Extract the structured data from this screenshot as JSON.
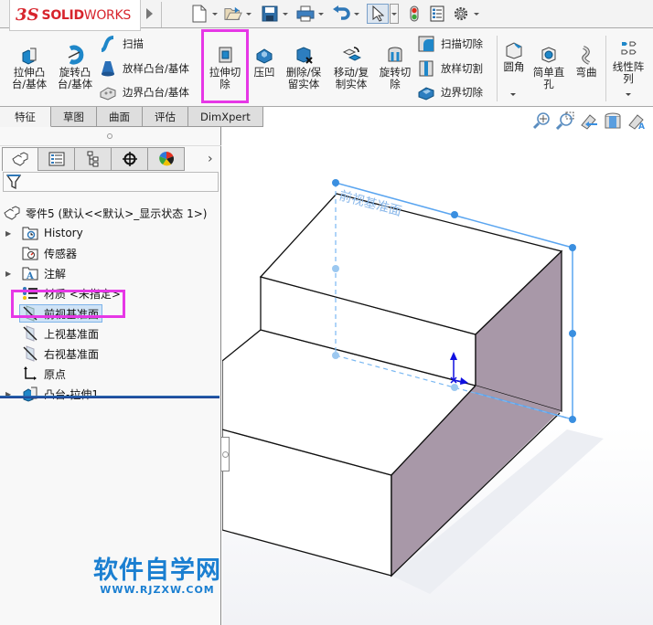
{
  "app": {
    "brand_mark": "3S",
    "brand_bold": "SOLID",
    "brand_light": "WORKS"
  },
  "quick_access": [
    {
      "name": "new-document",
      "icon": "document-icon"
    },
    {
      "name": "open",
      "icon": "folder-open-icon"
    },
    {
      "name": "save",
      "icon": "save-icon"
    },
    {
      "name": "print",
      "icon": "printer-icon"
    },
    {
      "name": "undo",
      "icon": "undo-icon"
    },
    {
      "name": "select",
      "icon": "cursor-icon"
    },
    {
      "name": "rebuild",
      "icon": "traffic-light-icon"
    },
    {
      "name": "file-properties",
      "icon": "properties-icon"
    },
    {
      "name": "options",
      "icon": "gear-icon"
    }
  ],
  "ribbon": {
    "extrude_boss_l1": "拉伸凸",
    "extrude_boss_l2": "台/基体",
    "revolve_boss_l1": "旋转凸",
    "revolve_boss_l2": "台/基体",
    "sweep": "扫描",
    "loft_boss": "放样凸台/基体",
    "boundary_boss": "边界凸台/基体",
    "extrude_cut_l1": "拉伸切",
    "extrude_cut_l2": "除",
    "indent": "压凹",
    "delete_keep_l1": "删除/保",
    "delete_keep_l2": "留实体",
    "move_copy_l1": "移动/复",
    "move_copy_l2": "制实体",
    "revolve_cut_l1": "旋转切",
    "revolve_cut_l2": "除",
    "swept_cut": "扫描切除",
    "lofted_cut": "放样切割",
    "boundary_cut": "边界切除",
    "fillet": "圆角",
    "simple_hole_l1": "简单直",
    "simple_hole_l2": "孔",
    "flex": "弯曲",
    "linear_pattern_l1": "线性阵",
    "linear_pattern_l2": "列"
  },
  "tabs": [
    "特征",
    "草图",
    "曲面",
    "评估",
    "DimXpert"
  ],
  "active_tab": "特征",
  "panel_tabs": [
    {
      "name": "feature-manager",
      "icon": "part-icon"
    },
    {
      "name": "property-manager",
      "icon": "list-icon"
    },
    {
      "name": "configuration-manager",
      "icon": "config-tree-icon"
    },
    {
      "name": "dimxpert-manager",
      "icon": "crosshair-icon"
    },
    {
      "name": "display-manager",
      "icon": "color-wheel-icon"
    }
  ],
  "tree": {
    "root": "零件5  (默认<<默认>_显示状态 1>)",
    "items": [
      {
        "label": "History",
        "expandable": true,
        "icon": "history-folder-icon"
      },
      {
        "label": "传感器",
        "expandable": false,
        "icon": "sensor-folder-icon"
      },
      {
        "label": "注解",
        "expandable": true,
        "icon": "annotation-folder-icon"
      },
      {
        "label": "材质 <未指定>",
        "expandable": false,
        "icon": "material-icon"
      },
      {
        "label": "前视基准面",
        "expandable": false,
        "icon": "plane-icon",
        "selected": true
      },
      {
        "label": "上视基准面",
        "expandable": false,
        "icon": "plane-icon"
      },
      {
        "label": "右视基准面",
        "expandable": false,
        "icon": "plane-icon"
      },
      {
        "label": "原点",
        "expandable": false,
        "icon": "origin-icon"
      },
      {
        "label": "凸台-拉伸1",
        "expandable": true,
        "icon": "extrude-feature-icon"
      }
    ]
  },
  "viewport": {
    "plane_label": "前视基准面",
    "model_face_color": "#a898a8",
    "plane_color": "#5aa5f0"
  },
  "watermark": {
    "cn": "软件自学网",
    "en": "WWW.RJZXW.COM"
  },
  "colors": {
    "brand_red": "#d7242c",
    "highlight_magenta": "#e637e6",
    "selection_blue": "#cfe3f6",
    "watermark_blue": "#1b7fd1"
  }
}
